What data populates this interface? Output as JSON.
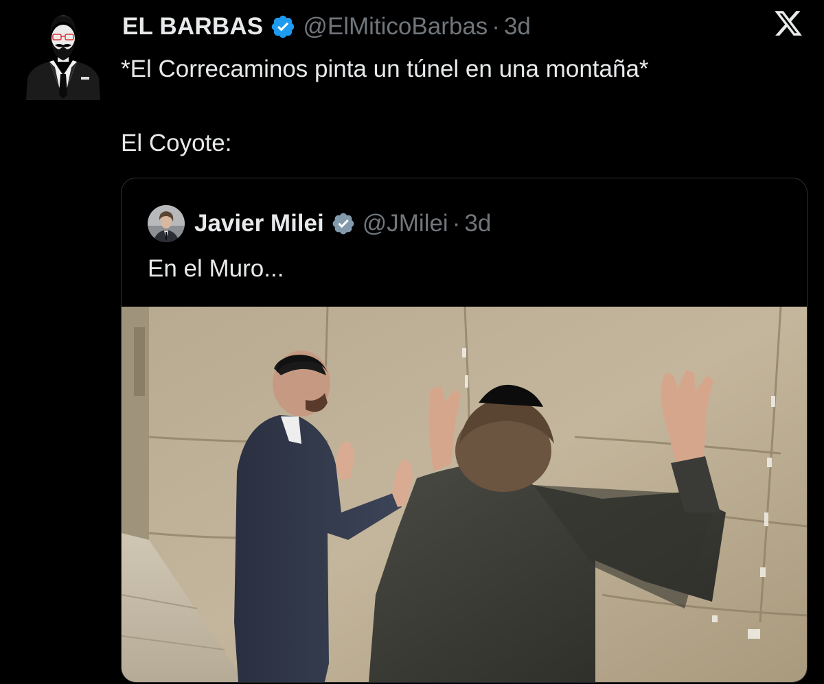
{
  "tweet": {
    "display_name": "EL BARBAS",
    "handle": "@ElMiticoBarbas",
    "separator": "·",
    "time": "3d",
    "text": "*El Correcaminos pinta un túnel en una montaña*\n\nEl Coyote:"
  },
  "quoted_tweet": {
    "display_name": "Javier Milei",
    "handle": "@JMilei",
    "separator": "·",
    "time": "3d",
    "text": "En el Muro..."
  },
  "icons": {
    "verified": "verified-badge-icon",
    "brand": "x-logo-icon"
  },
  "colors": {
    "background": "#000000",
    "text_primary": "#e7e9ea",
    "text_secondary": "#71767b",
    "verified_badge": "#1d9bf0",
    "quote_border": "#2f3336"
  }
}
